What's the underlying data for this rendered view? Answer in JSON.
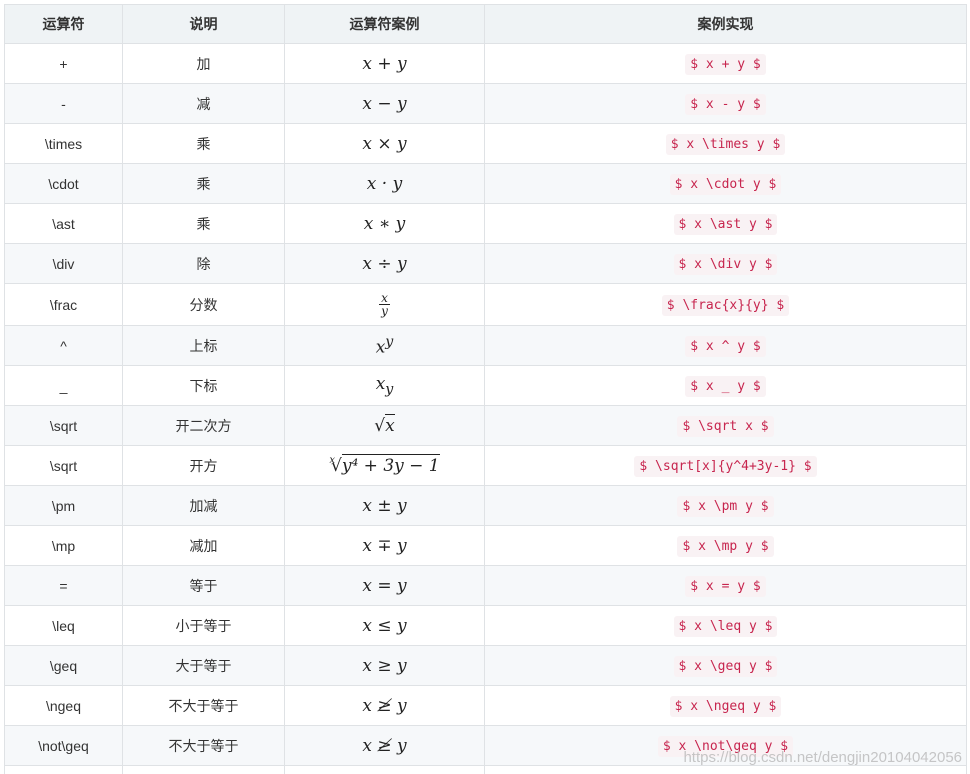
{
  "table": {
    "headers": [
      "运算符",
      "说明",
      "运算符案例",
      "案例实现"
    ],
    "rows": [
      {
        "op": "+",
        "desc": "加",
        "example": "x + y",
        "code": "$ x + y $"
      },
      {
        "op": "-",
        "desc": "减",
        "example": "x − y",
        "code": "$ x - y $"
      },
      {
        "op": "\\times",
        "desc": "乘",
        "example": "x × y",
        "code": "$ x \\times y $"
      },
      {
        "op": "\\cdot",
        "desc": "乘",
        "example": "x · y",
        "code": "$ x \\cdot y $"
      },
      {
        "op": "\\ast",
        "desc": "乘",
        "example": "x ∗ y",
        "code": "$ x \\ast y $"
      },
      {
        "op": "\\div",
        "desc": "除",
        "example": "x ÷ y",
        "code": "$ x \\div y $"
      },
      {
        "op": "\\frac",
        "desc": "分数",
        "example_num": "x",
        "example_den": "y",
        "code": "$ \\frac{x}{y} $"
      },
      {
        "op": "^",
        "desc": "上标",
        "example_base": "x",
        "example_sup": "y",
        "code": "$ x ^ y $"
      },
      {
        "op": "_",
        "desc": "下标",
        "example_base": "x",
        "example_sub": "y",
        "code": "$ x _ y $"
      },
      {
        "op": "\\sqrt",
        "desc": "开二次方",
        "example_radicand": "x",
        "code": "$ \\sqrt x $"
      },
      {
        "op": "\\sqrt",
        "desc": "开方",
        "example_index": "x",
        "example_radicand": "y⁴ + 3y − 1",
        "code": "$ \\sqrt[x]{y^4+3y-1} $"
      },
      {
        "op": "\\pm",
        "desc": "加减",
        "example": "x ± y",
        "code": "$ x \\pm y $"
      },
      {
        "op": "\\mp",
        "desc": "减加",
        "example": "x ∓ y",
        "code": "$ x \\mp y $"
      },
      {
        "op": "=",
        "desc": "等于",
        "example": "x = y",
        "code": "$ x = y $"
      },
      {
        "op": "\\leq",
        "desc": "小于等于",
        "example": "x ≤ y",
        "code": "$ x \\leq y $"
      },
      {
        "op": "\\geq",
        "desc": "大于等于",
        "example": "x ≥ y",
        "code": "$ x \\geq y $"
      },
      {
        "op": "\\ngeq",
        "desc": "不大于等于",
        "example": "x ≱ y",
        "code": "$ x \\ngeq y $"
      },
      {
        "op": "\\not\\geq",
        "desc": "不大于等于",
        "example": "x ≱ y",
        "code": "$ x \\not\\geq y $"
      }
    ]
  },
  "watermark": "https://blog.csdn.net/dengjin20104042056"
}
